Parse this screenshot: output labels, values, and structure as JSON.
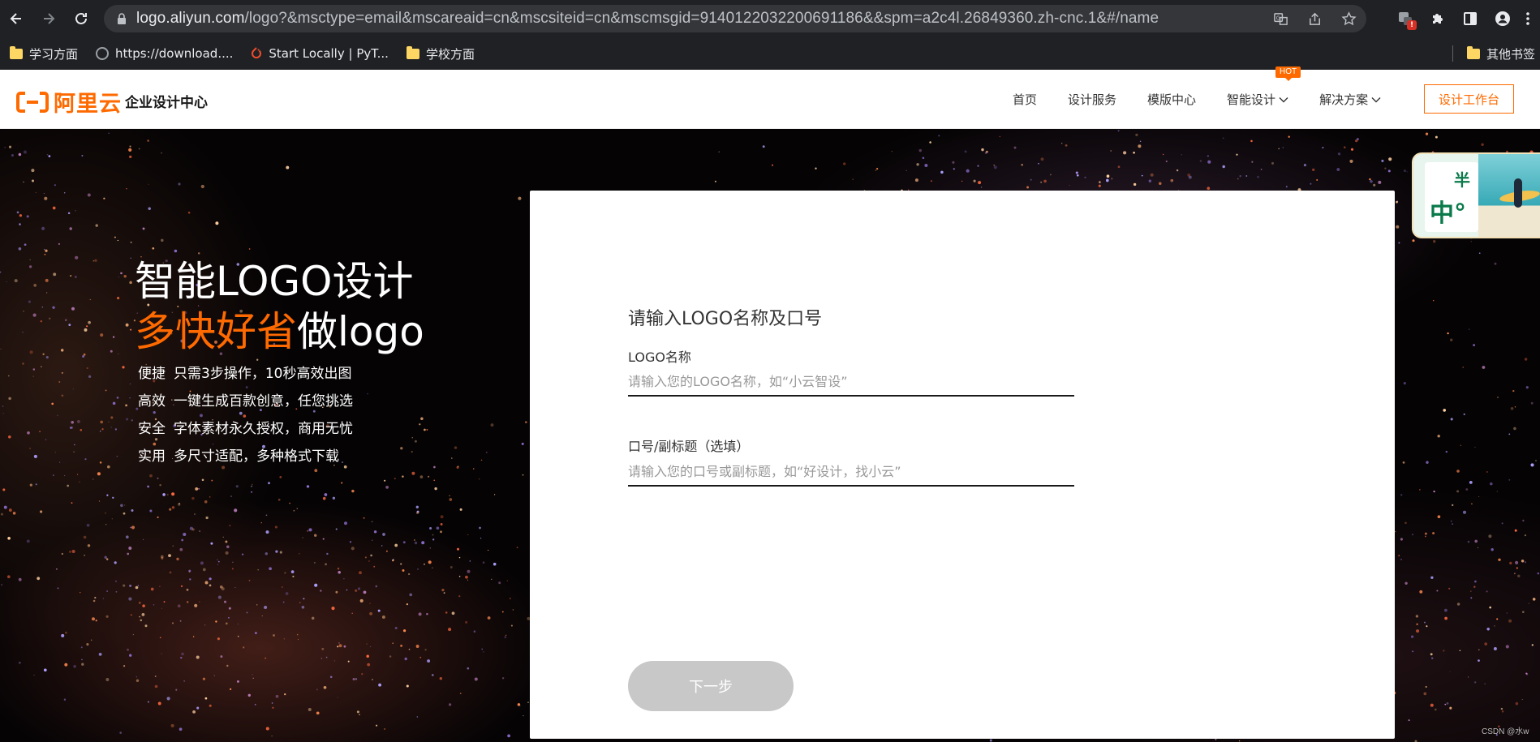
{
  "browser": {
    "url_host": "logo.aliyun.com",
    "url_path": "/logo?&msctype=email&mscareaid=cn&mscsiteid=cn&mscmsgid=9140122032200691186&&spm=a2c4l.26849360.zh-cnc.1&#/name",
    "bookmarks": [
      {
        "label": "学习方面",
        "icon": "folder-icon"
      },
      {
        "label": "https://download....",
        "icon": "globe-icon"
      },
      {
        "label": "Start Locally | PyT...",
        "icon": "pytorch-icon"
      },
      {
        "label": "学校方面",
        "icon": "folder-icon"
      }
    ],
    "other_bookmarks": "其他书签",
    "extension_badge": "!"
  },
  "header": {
    "logo_text": "阿里云",
    "site_name": "企业设计中心",
    "nav": [
      {
        "label": "首页",
        "dropdown": false
      },
      {
        "label": "设计服务",
        "dropdown": false
      },
      {
        "label": "模版中心",
        "dropdown": false
      },
      {
        "label": "智能设计",
        "dropdown": true,
        "badge": "HOT"
      },
      {
        "label": "解决方案",
        "dropdown": true
      }
    ],
    "workbench_button": "设计工作台",
    "accent_color": "#ff6a00"
  },
  "hero": {
    "title_line1": "智能LOGO设计",
    "title_line2_accent": "多快好省",
    "title_line2_rest": "做logo",
    "features": [
      {
        "key": "便捷",
        "text": "只需3步操作，10秒高效出图"
      },
      {
        "key": "高效",
        "text": "一键生成百款创意，任您挑选"
      },
      {
        "key": "安全",
        "text": "字体素材永久授权，商用无忧"
      },
      {
        "key": "实用",
        "text": "多尺寸适配，多种格式下载"
      }
    ]
  },
  "form": {
    "title": "请输入LOGO名称及口号",
    "name_label": "LOGO名称",
    "name_placeholder": "请输入您的LOGO名称，如“小云智设”",
    "name_value": "",
    "slogan_label": "口号/副标题（选填）",
    "slogan_placeholder": "请输入您的口号或副标题，如“好设计，找小云”",
    "slogan_value": "",
    "next_button": "下一步"
  },
  "float_ad": {
    "text_top": "半",
    "text_bottom": "中°"
  },
  "watermark": "CSDN @水w"
}
